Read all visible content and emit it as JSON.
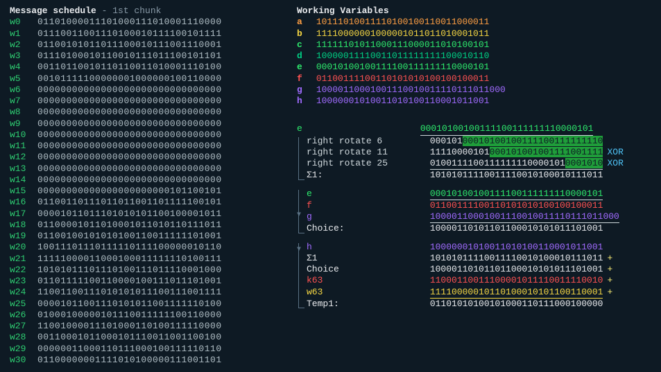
{
  "left": {
    "title": "Message schedule",
    "subtitle": " - 1st chunk",
    "words": [
      {
        "label": "w0",
        "bits": "01101000011101000111010001110000"
      },
      {
        "label": "w1",
        "bits": "01110011001110100010111100101111"
      },
      {
        "label": "w2",
        "bits": "01100101011011100010111001110001"
      },
      {
        "label": "w3",
        "bits": "01110100010110010111011100101101"
      },
      {
        "label": "w4",
        "bits": "00110110010110110011010001110100"
      },
      {
        "label": "w5",
        "bits": "00101111100000001000000100110000"
      },
      {
        "label": "w6",
        "bits": "00000000000000000000000000000000"
      },
      {
        "label": "w7",
        "bits": "00000000000000000000000000000000"
      },
      {
        "label": "w8",
        "bits": "00000000000000000000000000000000"
      },
      {
        "label": "w9",
        "bits": "00000000000000000000000000000000"
      },
      {
        "label": "w10",
        "bits": "00000000000000000000000000000000"
      },
      {
        "label": "w11",
        "bits": "00000000000000000000000000000000"
      },
      {
        "label": "w12",
        "bits": "00000000000000000000000000000000"
      },
      {
        "label": "w13",
        "bits": "00000000000000000000000000000000"
      },
      {
        "label": "w14",
        "bits": "00000000000000000000000000000000"
      },
      {
        "label": "w15",
        "bits": "00000000000000000000000101100101"
      },
      {
        "label": "w16",
        "bits": "01100110111011011001101111100101"
      },
      {
        "label": "w17",
        "bits": "00001011011101010101100100001011"
      },
      {
        "label": "w18",
        "bits": "01100001011010001011010110111011"
      },
      {
        "label": "w19",
        "bits": "01100100101010100110011111101001"
      },
      {
        "label": "w20",
        "bits": "10011101110111110111100000010110"
      },
      {
        "label": "w21",
        "bits": "11111000011000100011111110100111"
      },
      {
        "label": "w22",
        "bits": "10101011101110100111011110001000"
      },
      {
        "label": "w23",
        "bits": "01101111100110000100111011101001"
      },
      {
        "label": "w24",
        "bits": "11001100111010101011100111001111"
      },
      {
        "label": "w25",
        "bits": "00001011001110101011001111110100"
      },
      {
        "label": "w26",
        "bits": "01000100000101110011111100110000"
      },
      {
        "label": "w27",
        "bits": "11001000011101000110100111110000"
      },
      {
        "label": "w28",
        "bits": "00110001011000101110011001100100"
      },
      {
        "label": "w29",
        "bits": "00000011000110111000100111110110"
      },
      {
        "label": "w30",
        "bits": "01100000001111010100000111001101"
      }
    ]
  },
  "workingVars": {
    "title": "Working Variables",
    "vars": [
      {
        "name": "a",
        "cls": "var-a",
        "bits": "10111010011110100100110011000011"
      },
      {
        "name": "b",
        "cls": "var-b",
        "bits": "11110000001000001011011010001011"
      },
      {
        "name": "c",
        "cls": "var-c",
        "bits": "11111101011000111000011010100101"
      },
      {
        "name": "d",
        "cls": "var-d",
        "bits": "10000011110011011111111100010110"
      },
      {
        "name": "e",
        "cls": "var-e",
        "bits": "00010100100111100111111110000101"
      },
      {
        "name": "f",
        "cls": "var-f",
        "bits": "01100111100110101010100100100011"
      },
      {
        "name": "g",
        "cls": "var-g",
        "bits": "10000110001001110010011110111011000"
      },
      {
        "name": "h",
        "cls": "var-h",
        "bits": "10000001010011010100110001011001"
      }
    ]
  },
  "ops": {
    "e_label": "e",
    "e_bits": "00010100100111100111111110000101",
    "rot6_label": "right rotate 6",
    "rot6_plain": "000101",
    "rot6_hl": "00010100100111100111111110",
    "rot11_label": "right rotate 11",
    "rot11_plain": "11110000101",
    "rot11_hl": "000101001001111001111",
    "rot11_op": "XOR",
    "rot25_label": "right rotate 25",
    "rot25_plain": "0100111100111111110000101",
    "rot25_hl": "0001010",
    "rot25_op": "XOR",
    "sigma1_label": "Σ1:",
    "sigma1_bits": "10101011110011110010100010111011",
    "e2_bits": "00010100100111100111111110000101",
    "f_label": "f",
    "f_bits": "01100111100110101010100100100011",
    "g_label": "g",
    "g_bits": "10000110001001110010011110111011000",
    "choice_label": "Choice:",
    "choice_bits": "10000110101101100010101011101001",
    "h_label": "h",
    "h_bits": "10000001010011010100110001011001",
    "sigma1_row_label": "Σ1",
    "sigma1_row_bits": "10101011110011110010100010111011",
    "choice_row_label": "Choice",
    "choice_row_bits": "10000110101101100010101011101001",
    "k63_label": "k63",
    "k63_bits": "11000110011100001011110011110010",
    "w63_label": "w63",
    "w63_bits": "11110000010110100010101100110001",
    "temp1_label": "Temp1:",
    "temp1_bits": "01101010100101000110111000100000",
    "plus": "+"
  }
}
